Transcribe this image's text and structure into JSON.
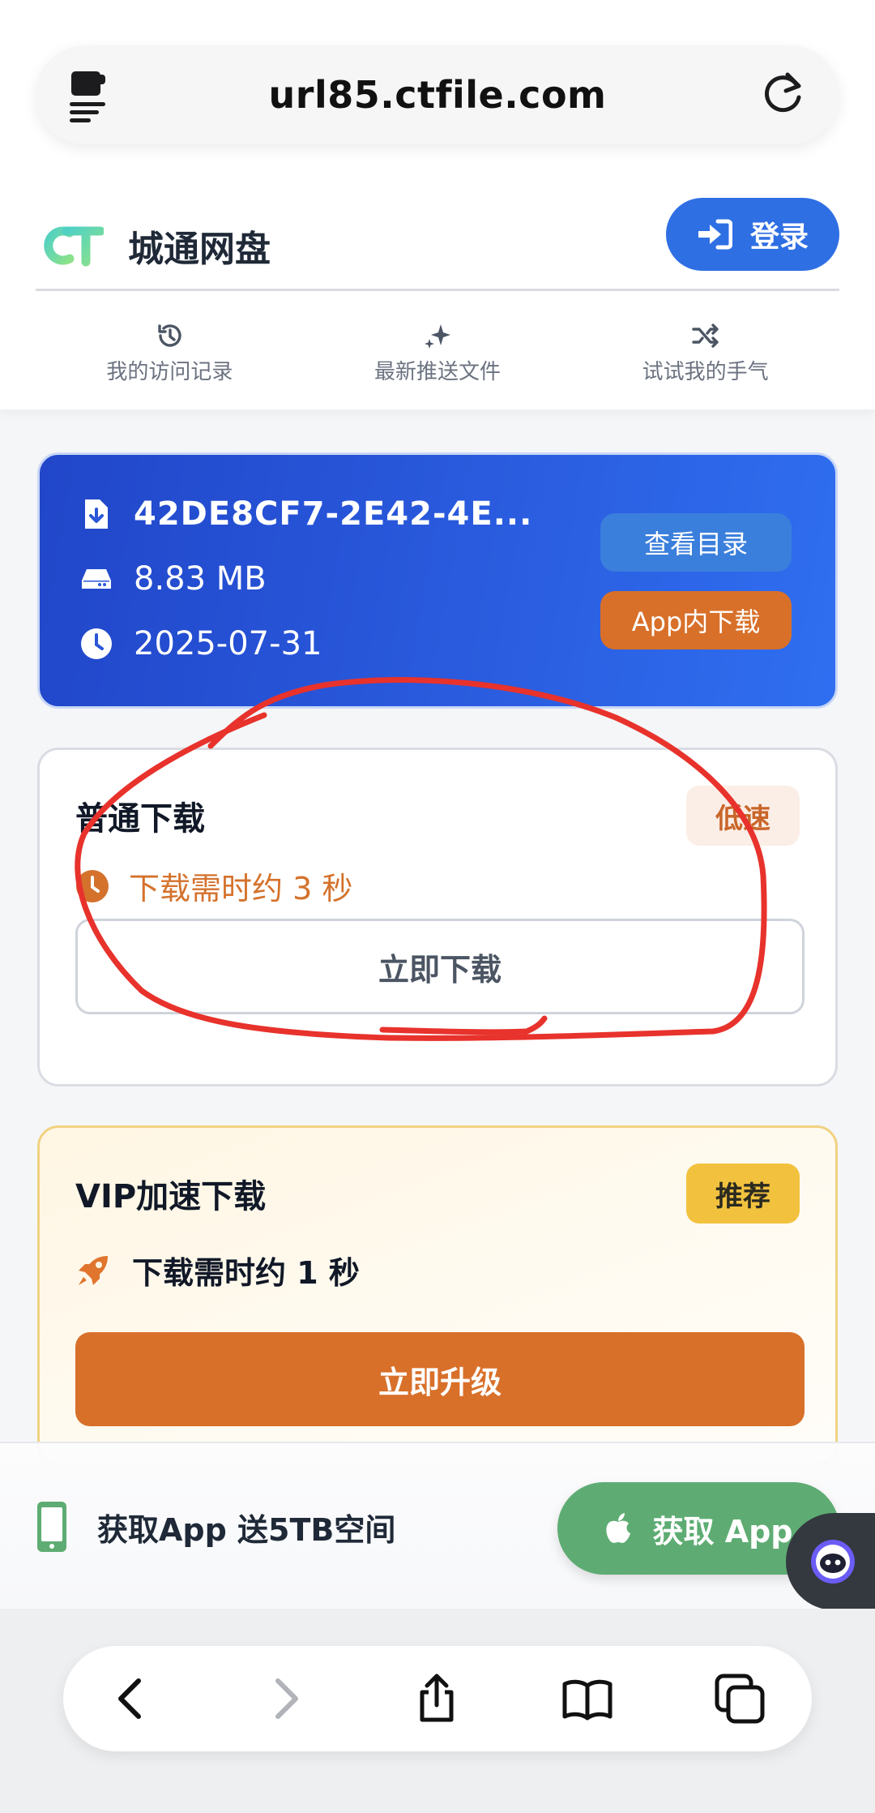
{
  "browser": {
    "url": "url85.ctfile.com"
  },
  "header": {
    "brand_name": "城通网盘",
    "login_label": "登录",
    "nav": [
      {
        "label": "我的访问记录",
        "icon": "history-icon"
      },
      {
        "label": "最新推送文件",
        "icon": "sparkle-icon"
      },
      {
        "label": "试试我的手气",
        "icon": "shuffle-icon"
      }
    ]
  },
  "file": {
    "name": "42DE8CF7-2E42-4E...",
    "size": "8.83 MB",
    "date": "2025-07-31",
    "view_dir_label": "查看目录",
    "app_download_label": "App内下载"
  },
  "normal_download": {
    "title": "普通下载",
    "badge": "低速",
    "time_text": "下载需时约 3 秒",
    "button_label": "立即下载"
  },
  "vip_download": {
    "title": "VIP加速下载",
    "badge": "推荐",
    "time_text": "下载需时约 1 秒",
    "button_label": "立即升级"
  },
  "promo": {
    "text": "获取App 送5TB空间",
    "button_label": "获取 App"
  },
  "colors": {
    "primary_blue": "#2f6fe4",
    "orange": "#d8702a",
    "green": "#5eac73",
    "annotation_red": "#e8322c"
  }
}
